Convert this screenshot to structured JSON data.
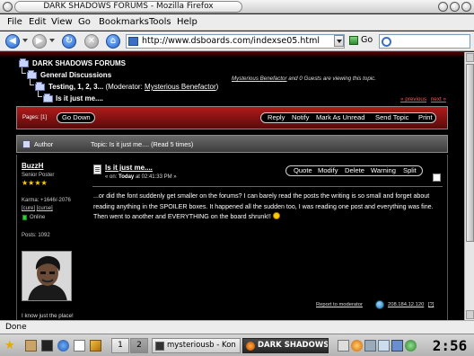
{
  "window": {
    "title": "DARK SHADOWS FORUMS - Mozilla Firefox"
  },
  "menu": {
    "file": "File",
    "edit": "Edit",
    "view": "View",
    "go": "Go",
    "bookmarks": "Bookmarks",
    "tools": "Tools",
    "help": "Help"
  },
  "nav": {
    "url": "http://www.dsboards.com/indexse05.html",
    "go_label": "Go"
  },
  "breadcrumb": {
    "forum": "DARK SHADOWS FORUMS",
    "board": "General Discussions",
    "subboard": "Testing, 1, 2, 3...",
    "moderator_prefix": "(Moderator:",
    "moderator_name": "Mysterious Benefactor",
    "moderator_suffix": ")",
    "topic": "Is it just me...."
  },
  "viewers": {
    "user": "Mysterious Benefactor",
    "rest": "and 0 Guests are viewing this topic."
  },
  "pagination": {
    "prev": "« previous",
    "next": "next »",
    "pages_label": "Pages: [1]"
  },
  "topic_buttons": {
    "go_down": "Go Down",
    "reply": "Reply",
    "notify": "Notify",
    "mark_unread": "Mark As Unread",
    "send_topic": "Send Topic",
    "print": "Print"
  },
  "header_band": {
    "author_label": "Author",
    "topic_label": "Topic: Is it just me....  (Read 5 times)"
  },
  "author": {
    "name": "BuzzH",
    "rank": "Senior Poster",
    "stars": "★★★★",
    "karma": "Karma: +1646/-2076",
    "cure": "[cure]",
    "curse": "[curse]",
    "status": "Online",
    "posts": "Posts: 1092",
    "signature": "I know just the place!"
  },
  "post": {
    "title": "Is it just me....",
    "date_prefix": "« on:",
    "date_today": "Today",
    "date_time": "at 02:41:33 PM »",
    "buttons": {
      "quote": "Quote",
      "modify": "Modify",
      "delete": "Delete",
      "warning": "Warning",
      "split": "Split"
    },
    "body": "...or did the font suddenly get smaller on the forums?  I can barely read the posts the writing is so small and forget about reading anything in the SPOILER boxes.  It happened all the sudden too, I was reading one post and everything was fine.  Then went to another and EVERYTHING on the board shrunk!! ",
    "report": "Report to moderator",
    "ip": "208.184.12.120",
    "ip_tag": "[?]"
  },
  "status": {
    "text": "Done"
  },
  "taskbar": {
    "desk1": "1",
    "desk2": "2",
    "task1": "mysteriousb - Kon",
    "task2": "DARK SHADOWS",
    "clock": "2:56"
  }
}
